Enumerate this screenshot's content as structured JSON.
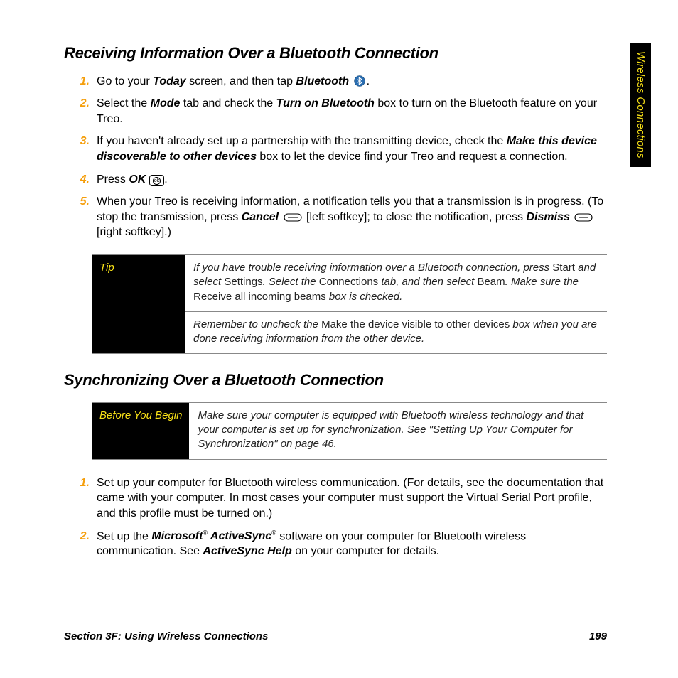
{
  "sideTab": "Wireless Connections",
  "section1": {
    "title": "Receiving Information Over a Bluetooth Connection",
    "steps": {
      "s1_a": "Go to your ",
      "s1_b": "Today",
      "s1_c": " screen, and then tap ",
      "s1_d": "Bluetooth",
      "s1_e": ".",
      "s2_a": "Select the ",
      "s2_b": "Mode",
      "s2_c": " tab and check the ",
      "s2_d": "Turn on Bluetooth",
      "s2_e": " box to turn on the Bluetooth feature on your Treo.",
      "s3_a": "If you haven't already set up a partnership with the transmitting device, check the ",
      "s3_b": "Make this device discoverable to other devices",
      "s3_c": " box to let the device find your Treo and request a connection.",
      "s4_a": "Press ",
      "s4_b": "OK",
      "s4_c": ".",
      "s5_a": "When your Treo is receiving information, a notification tells you that a transmission is in progress. (To stop the transmission, press ",
      "s5_b": "Cancel",
      "s5_c": " [left softkey]; to close the notification, press ",
      "s5_d": "Dismiss",
      "s5_e": " [right softkey].)"
    }
  },
  "tipBox": {
    "label": "Tip",
    "row1_a": "If you have trouble receiving information over a Bluetooth connection, press ",
    "row1_b": "Start",
    "row1_c": " and select ",
    "row1_d": "Settings",
    "row1_e": ". Select the ",
    "row1_f": "Connections",
    "row1_g": " tab, and then select ",
    "row1_h": "Beam",
    "row1_i": ". Make sure the ",
    "row1_j": "Receive all incoming beams",
    "row1_k": " box is checked.",
    "row2_a": "Remember to uncheck the ",
    "row2_b": "Make the device visible to other devices",
    "row2_c": " box when you are done receiving information from the other device."
  },
  "section2": {
    "title": "Synchronizing Over a Bluetooth Connection"
  },
  "beforeBox": {
    "label": "Before You Begin",
    "row1": "Make sure your computer is equipped with Bluetooth wireless technology and that your computer is set up for synchronization. See \"Setting Up Your Computer for Synchronization\" on page 46."
  },
  "section2steps": {
    "s1": "Set up your computer for Bluetooth wireless communication. (For details, see the documentation that came with your computer. In most cases your computer must support the Virtual Serial Port profile, and this profile must be turned on.)",
    "s2_a": "Set up the ",
    "s2_b": "Microsoft",
    "s2_c": " ActiveSync",
    "s2_d": " software on your computer for Bluetooth wireless communication. See ",
    "s2_e": "ActiveSync Help",
    "s2_f": " on your computer for details."
  },
  "footer": {
    "left": "Section 3F: Using Wireless Connections",
    "right": "199"
  },
  "nums": {
    "n1": "1.",
    "n2": "2.",
    "n3": "3.",
    "n4": "4.",
    "n5": "5."
  },
  "okGlyph": "ok"
}
